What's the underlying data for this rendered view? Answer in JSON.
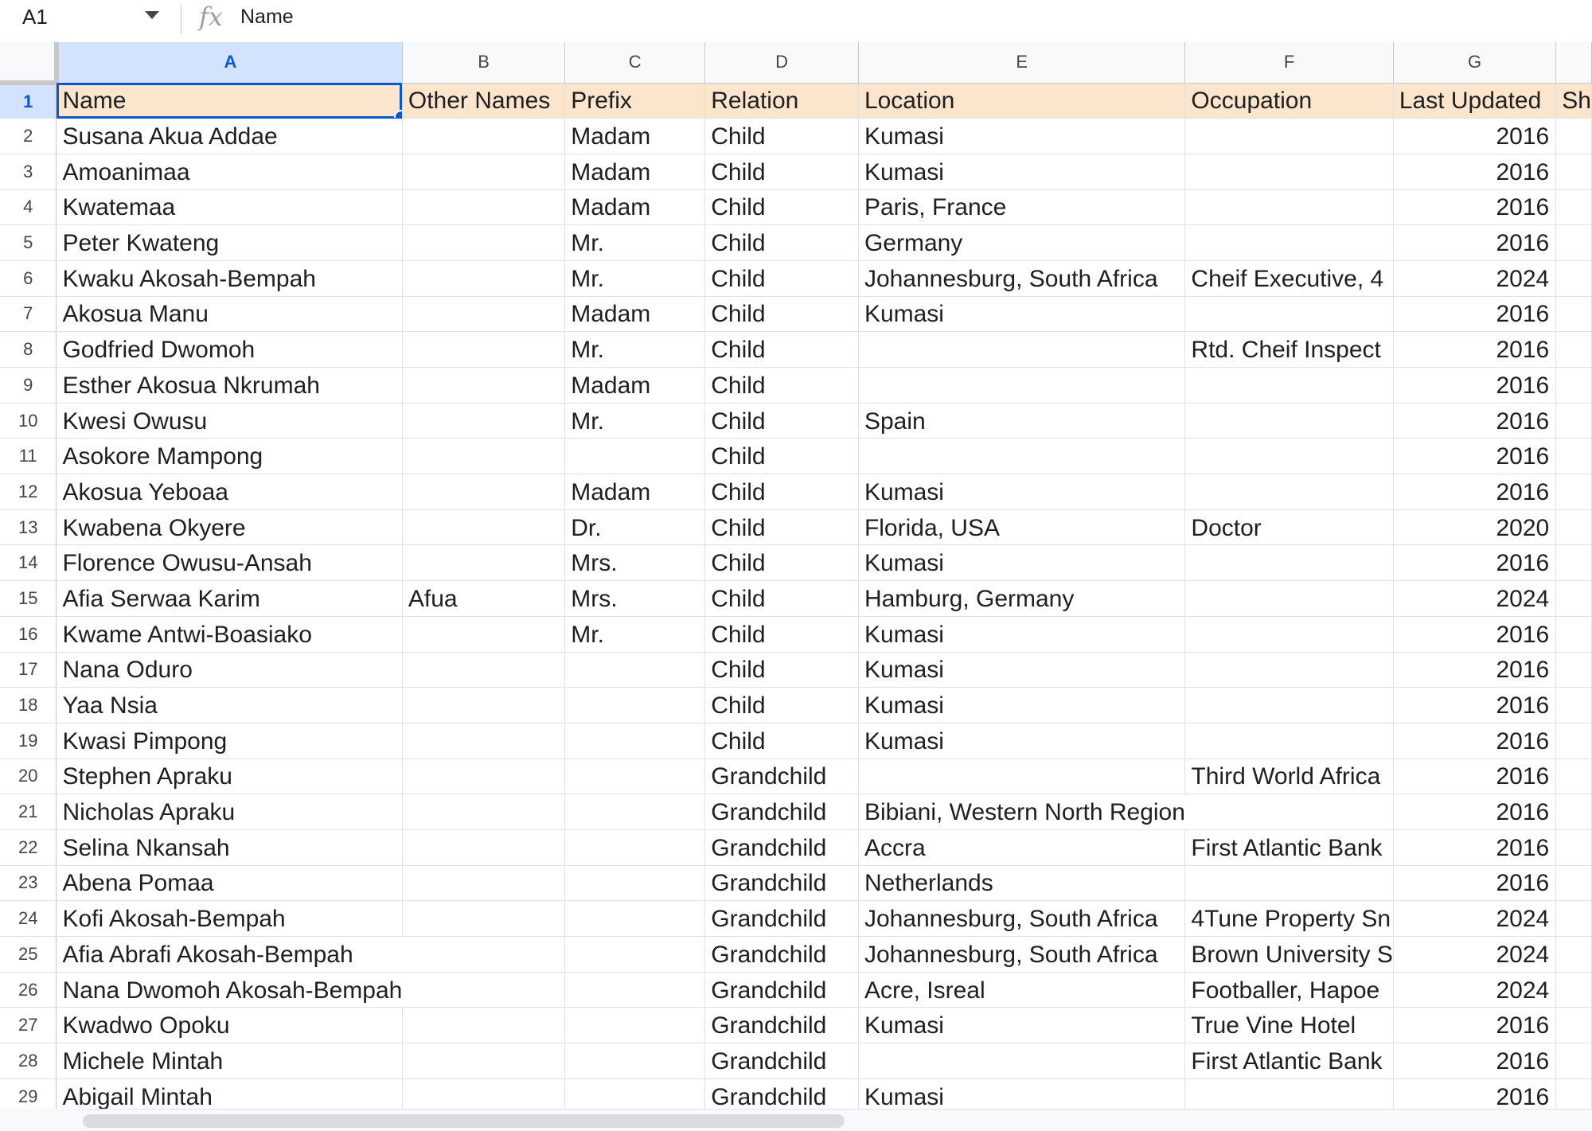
{
  "formula_bar": {
    "cell_ref": "A1",
    "fx_label": "fx",
    "content": "Name"
  },
  "columns": [
    "A",
    "B",
    "C",
    "D",
    "E",
    "F",
    "G",
    ""
  ],
  "header": {
    "row_num": "1",
    "cells": [
      "Name",
      "Other Names",
      "Prefix",
      "Relation",
      "Location",
      "Occupation",
      "Last Updated",
      "Sh"
    ]
  },
  "rows": [
    {
      "num": "2",
      "name": "Susana Akua Addae",
      "other": "",
      "prefix": "Madam",
      "relation": "Child",
      "location": "Kumasi",
      "occupation": "",
      "updated": "2016"
    },
    {
      "num": "3",
      "name": "Amoanimaa",
      "other": "",
      "prefix": "Madam",
      "relation": "Child",
      "location": "Kumasi",
      "occupation": "",
      "updated": "2016"
    },
    {
      "num": "4",
      "name": "Kwatemaa",
      "other": "",
      "prefix": "Madam",
      "relation": "Child",
      "location": "Paris, France",
      "occupation": "",
      "updated": "2016"
    },
    {
      "num": "5",
      "name": "Peter Kwateng",
      "other": "",
      "prefix": "Mr.",
      "relation": "Child",
      "location": "Germany",
      "occupation": "",
      "updated": "2016"
    },
    {
      "num": "6",
      "name": "Kwaku Akosah-Bempah",
      "other": "",
      "prefix": "Mr.",
      "relation": "Child",
      "location": "Johannesburg, South Africa",
      "occupation": "Cheif Executive, 4",
      "updated": "2024"
    },
    {
      "num": "7",
      "name": "Akosua Manu",
      "other": "",
      "prefix": "Madam",
      "relation": "Child",
      "location": "Kumasi",
      "occupation": "",
      "updated": "2016"
    },
    {
      "num": "8",
      "name": "Godfried Dwomoh",
      "other": "",
      "prefix": "Mr.",
      "relation": "Child",
      "location": "",
      "occupation": "Rtd. Cheif Inspect",
      "updated": "2016"
    },
    {
      "num": "9",
      "name": "Esther Akosua Nkrumah",
      "other": "",
      "prefix": "Madam",
      "relation": "Child",
      "location": "",
      "occupation": "",
      "updated": "2016"
    },
    {
      "num": "10",
      "name": "Kwesi Owusu",
      "other": "",
      "prefix": "Mr.",
      "relation": "Child",
      "location": "Spain",
      "occupation": "",
      "updated": "2016"
    },
    {
      "num": "11",
      "name": "Asokore Mampong",
      "other": "",
      "prefix": "",
      "relation": "Child",
      "location": "",
      "occupation": "",
      "updated": "2016"
    },
    {
      "num": "12",
      "name": "Akosua Yeboaa",
      "other": "",
      "prefix": "Madam",
      "relation": "Child",
      "location": "Kumasi",
      "occupation": "",
      "updated": "2016"
    },
    {
      "num": "13",
      "name": "Kwabena Okyere",
      "other": "",
      "prefix": "Dr.",
      "relation": "Child",
      "location": "Florida, USA",
      "occupation": "Doctor",
      "updated": "2020"
    },
    {
      "num": "14",
      "name": "Florence Owusu-Ansah",
      "other": "",
      "prefix": "Mrs.",
      "relation": "Child",
      "location": "Kumasi",
      "occupation": "",
      "updated": "2016"
    },
    {
      "num": "15",
      "name": "Afia Serwaa Karim",
      "other": "Afua",
      "prefix": "Mrs.",
      "relation": "Child",
      "location": "Hamburg, Germany",
      "occupation": "",
      "updated": "2024"
    },
    {
      "num": "16",
      "name": "Kwame Antwi-Boasiako",
      "other": "",
      "prefix": "Mr.",
      "relation": "Child",
      "location": "Kumasi",
      "occupation": "",
      "updated": "2016"
    },
    {
      "num": "17",
      "name": "Nana Oduro",
      "other": "",
      "prefix": "",
      "relation": "Child",
      "location": "Kumasi",
      "occupation": "",
      "updated": "2016"
    },
    {
      "num": "18",
      "name": "Yaa Nsia",
      "other": "",
      "prefix": "",
      "relation": "Child",
      "location": "Kumasi",
      "occupation": "",
      "updated": "2016"
    },
    {
      "num": "19",
      "name": "Kwasi Pimpong",
      "other": "",
      "prefix": "",
      "relation": "Child",
      "location": "Kumasi",
      "occupation": "",
      "updated": "2016"
    },
    {
      "num": "20",
      "name": "Stephen Apraku",
      "other": "",
      "prefix": "",
      "relation": "Grandchild",
      "location": "",
      "occupation": "Third World Africa",
      "updated": "2016"
    },
    {
      "num": "21",
      "name": "Nicholas Apraku",
      "other": "",
      "prefix": "",
      "relation": "Grandchild",
      "location": "Bibiani, Western North Region",
      "occupation": "",
      "updated": "2016"
    },
    {
      "num": "22",
      "name": "Selina Nkansah",
      "other": "",
      "prefix": "",
      "relation": "Grandchild",
      "location": "Accra",
      "occupation": "First Atlantic Bank",
      "updated": "2016"
    },
    {
      "num": "23",
      "name": "Abena Pomaa",
      "other": "",
      "prefix": "",
      "relation": "Grandchild",
      "location": "Netherlands",
      "occupation": "",
      "updated": "2016"
    },
    {
      "num": "24",
      "name": "Kofi Akosah-Bempah",
      "other": "",
      "prefix": "",
      "relation": "Grandchild",
      "location": "Johannesburg, South Africa",
      "occupation": "4Tune Property Sn",
      "updated": "2024"
    },
    {
      "num": "25",
      "name": "Afia Abrafi Akosah-Bempah",
      "other": "",
      "prefix": "",
      "relation": "Grandchild",
      "location": "Johannesburg, South Africa",
      "occupation": "Brown University S",
      "updated": "2024"
    },
    {
      "num": "26",
      "name": "Nana Dwomoh Akosah-Bempah",
      "other": "",
      "prefix": "",
      "relation": "Grandchild",
      "location": "Acre, Isreal",
      "occupation": "Footballer, Hapoe",
      "updated": "2024"
    },
    {
      "num": "27",
      "name": "Kwadwo Opoku",
      "other": "",
      "prefix": "",
      "relation": "Grandchild",
      "location": "Kumasi",
      "occupation": "True Vine Hotel",
      "updated": "2016"
    },
    {
      "num": "28",
      "name": "Michele Mintah",
      "other": "",
      "prefix": "",
      "relation": "Grandchild",
      "location": "",
      "occupation": "First Atlantic Bank",
      "updated": "2016"
    },
    {
      "num": "29",
      "name": "Abigail Mintah",
      "other": "",
      "prefix": "",
      "relation": "Grandchild",
      "location": "Kumasi",
      "occupation": "",
      "updated": "2016"
    }
  ]
}
